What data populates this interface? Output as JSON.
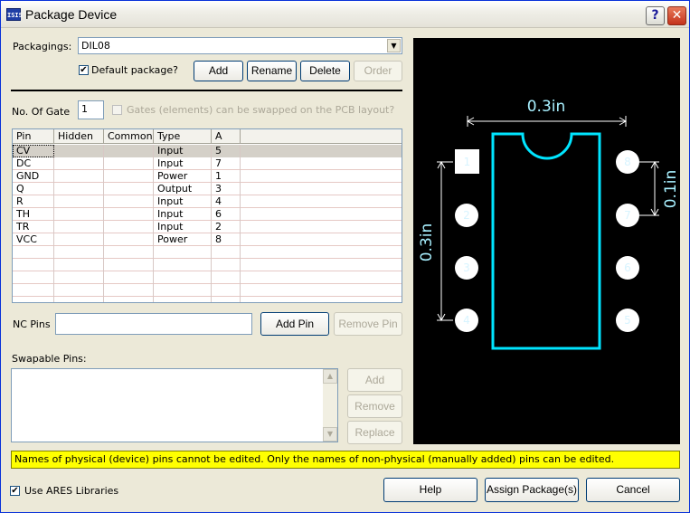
{
  "window": {
    "title": "Package Device",
    "app_icon_text": "ISIS",
    "help_glyph": "?",
    "close_glyph": "✕"
  },
  "packagings": {
    "label": "Packagings:",
    "value": "DIL08",
    "default_label": "Default package?",
    "default_checked": true,
    "add_label": "Add",
    "rename_label": "Rename",
    "delete_label": "Delete",
    "order_label": "Order"
  },
  "gates": {
    "label": "No. Of Gate",
    "value": "1",
    "swap_label": "Gates (elements) can be swapped on the PCB layout?"
  },
  "pin_table": {
    "columns": [
      "Pin",
      "Hidden",
      "Common",
      "Type",
      "A"
    ],
    "rows": [
      {
        "pin": "CV",
        "hidden": "",
        "common": "",
        "type": "Input",
        "a": "5"
      },
      {
        "pin": "DC",
        "hidden": "",
        "common": "",
        "type": "Input",
        "a": "7"
      },
      {
        "pin": "GND",
        "hidden": "",
        "common": "",
        "type": "Power",
        "a": "1"
      },
      {
        "pin": "Q",
        "hidden": "",
        "common": "",
        "type": "Output",
        "a": "3"
      },
      {
        "pin": "R",
        "hidden": "",
        "common": "",
        "type": "Input",
        "a": "4"
      },
      {
        "pin": "TH",
        "hidden": "",
        "common": "",
        "type": "Input",
        "a": "6"
      },
      {
        "pin": "TR",
        "hidden": "",
        "common": "",
        "type": "Input",
        "a": "2"
      },
      {
        "pin": "VCC",
        "hidden": "",
        "common": "",
        "type": "Power",
        "a": "8"
      }
    ],
    "empty_rows": 5,
    "selected_row": 0
  },
  "nc_pins": {
    "label": "NC Pins",
    "value": "",
    "add_pin_label": "Add Pin",
    "remove_pin_label": "Remove Pin"
  },
  "swapable": {
    "label": "Swapable Pins:",
    "add_label": "Add",
    "remove_label": "Remove",
    "replace_label": "Replace"
  },
  "status_message": "Names of physical (device) pins cannot be edited. Only the names of non-physical (manually added) pins can be edited.",
  "footer": {
    "ares_label": "Use ARES Libraries",
    "ares_checked": true,
    "help_label": "Help",
    "assign_label": "Assign Package(s)",
    "cancel_label": "Cancel"
  },
  "preview": {
    "dim_top": "0.3in",
    "dim_left": "0.3in",
    "dim_right": "0.1in",
    "left_pins": [
      "1",
      "2",
      "3",
      "4"
    ],
    "right_pins": [
      "8",
      "7",
      "6",
      "5"
    ],
    "colors": {
      "background": "#000000",
      "body_outline": "#00e5ff",
      "dimension": "#ffffff",
      "dimension_text": "#a8f0ff",
      "pad_fill": "#ffffff",
      "pad_text": "#d8f4ff"
    }
  }
}
